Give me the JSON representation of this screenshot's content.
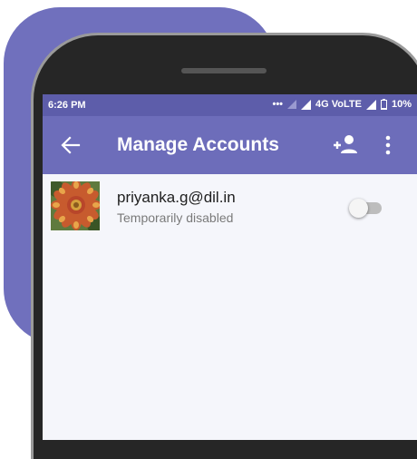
{
  "status_bar": {
    "time": "6:26 PM",
    "network": "4G VoLTE",
    "battery": "10%"
  },
  "app_bar": {
    "title": "Manage Accounts",
    "icons": [
      "back-arrow-icon",
      "add-person-icon",
      "more-vert-icon"
    ]
  },
  "accounts": [
    {
      "email": "priyanka.g@dil.in",
      "status": "Temporarily disabled",
      "enabled": false
    }
  ],
  "colors": {
    "background_blob": "#7070bd",
    "status_bar": "#5d5daa",
    "app_bar": "#6d6dba",
    "screen_background": "#f5f6fb",
    "phone_body": "#262626"
  }
}
